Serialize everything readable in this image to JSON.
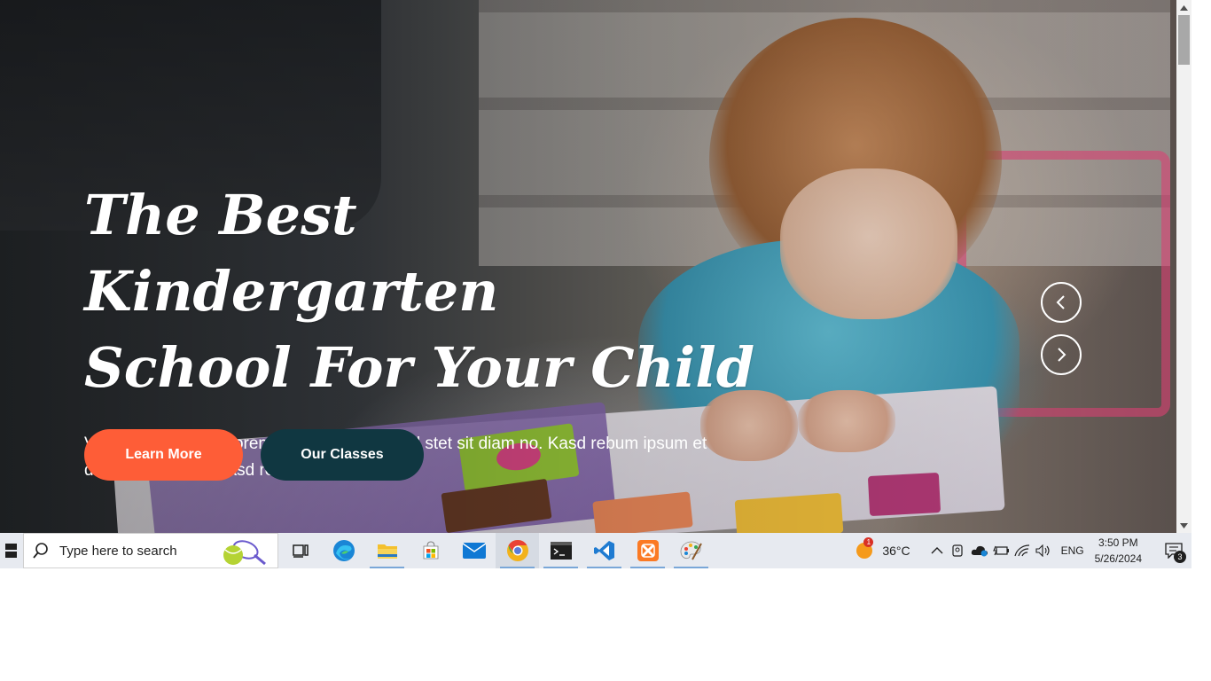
{
  "hero": {
    "title_line1": "The Best Kindergarten",
    "title_line2": "School For Your Child",
    "description": "Vero elitr justo clita lorem. Ipsum dolor at sed stet sit diam no. Kasd rebum ipsum et diam justo clita et kasd rebum sea elitr.",
    "primary_button": "Learn More",
    "secondary_button": "Our Classes",
    "prev_icon": "chevron-left-icon",
    "next_icon": "chevron-right-icon"
  },
  "colors": {
    "primary": "#fe5d37",
    "dark": "#103741"
  },
  "taskbar": {
    "search_placeholder": "Type here to search",
    "apps": [
      {
        "name": "task-view",
        "icon": "task-view-icon"
      },
      {
        "name": "edge",
        "icon": "edge-icon"
      },
      {
        "name": "file-explorer",
        "icon": "folder-icon"
      },
      {
        "name": "microsoft-store",
        "icon": "store-icon"
      },
      {
        "name": "mail",
        "icon": "mail-icon"
      },
      {
        "name": "chrome",
        "icon": "chrome-icon"
      },
      {
        "name": "terminal",
        "icon": "terminal-icon"
      },
      {
        "name": "vscode",
        "icon": "vscode-icon"
      },
      {
        "name": "xampp",
        "icon": "xampp-icon"
      },
      {
        "name": "paint",
        "icon": "palette-icon"
      }
    ],
    "weather": {
      "temperature": "36°C",
      "badge": "1"
    },
    "language": "ENG",
    "time": "3:50 PM",
    "date": "5/26/2024",
    "notification_count": "3"
  }
}
